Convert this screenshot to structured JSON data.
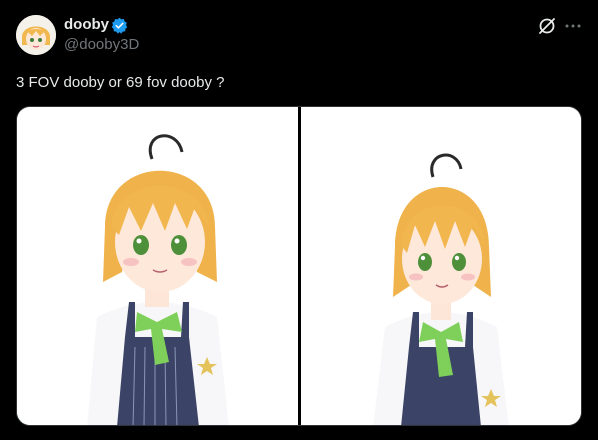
{
  "post": {
    "author": {
      "display_name": "dooby",
      "handle": "@dooby3D",
      "verified": true,
      "avatar_icon": "avatar-anime-girl"
    },
    "text": "3 FOV dooby or 69 fov dooby ?",
    "actions": {
      "grok_icon": "grok-icon",
      "more_icon": "more-options-icon"
    },
    "media": [
      {
        "kind": "image",
        "description_icon": "anime-character-image"
      },
      {
        "kind": "image",
        "description_icon": "anime-character-image"
      }
    ]
  },
  "colors": {
    "background": "#000000",
    "text_primary": "#e7e9ea",
    "text_secondary": "#71767b",
    "verified_blue": "#1d9bf0"
  }
}
